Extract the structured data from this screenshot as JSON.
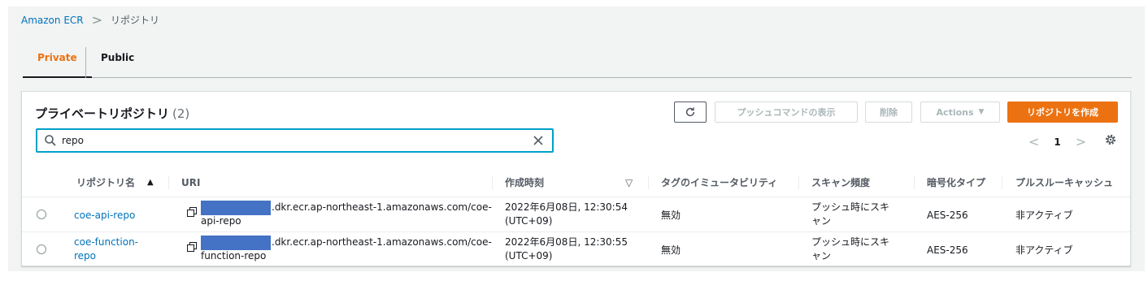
{
  "breadcrumb": {
    "root": "Amazon ECR",
    "separator": ">",
    "current": "リポジトリ"
  },
  "tabs": [
    {
      "label": "Private"
    },
    {
      "label": "Public"
    }
  ],
  "panel": {
    "title": "プライベートリポジトリ",
    "count": "(2)",
    "buttons": {
      "push_commands": "プッシュコマンドの表示",
      "delete": "削除",
      "actions": "Actions",
      "actions_caret": "▼",
      "create": "リポジトリを作成"
    },
    "search": {
      "value": "repo"
    },
    "pagination": {
      "prev": "<",
      "page": "1",
      "next": ">"
    }
  },
  "table": {
    "headers": {
      "name": "リポジトリ名",
      "sort_arrow": "▲",
      "uri": "URI",
      "created": "作成時刻",
      "created_sort": "▽",
      "tag_mutability": "タグのイミュータビリティ",
      "scan_frequency": "スキャン頻度",
      "encryption": "暗号化タイプ",
      "pull_through": "プルスルーキャッシュ"
    },
    "rows": [
      {
        "name_line1": "coe-api-repo",
        "name_line2": "",
        "uri_line1": ".dkr.ecr.ap-northeast-1.amazonaws.com/coe-",
        "uri_line2": "api-repo",
        "created_line1": "2022年6月08日, 12:30:54",
        "created_line2": "(UTC+09)",
        "tag_mutability": "無効",
        "scan_line1": "プッシュ時にスキ",
        "scan_line2": "ャン",
        "encryption": "AES-256",
        "pull_through": "非アクティブ"
      },
      {
        "name_line1": "coe-function-",
        "name_line2": "repo",
        "uri_line1": ".dkr.ecr.ap-northeast-1.amazonaws.com/coe-",
        "uri_line2": "function-repo",
        "created_line1": "2022年6月08日, 12:30:55",
        "created_line2": "(UTC+09)",
        "tag_mutability": "無効",
        "scan_line1": "プッシュ時にスキ",
        "scan_line2": "ャン",
        "encryption": "AES-256",
        "pull_through": "非アクティブ"
      }
    ]
  },
  "colors": {
    "accent": "#ec7211",
    "link": "#0073bb",
    "focus": "#00a1c9",
    "redaction": "#4472c4"
  },
  "icons": [
    "refresh-icon",
    "search-icon",
    "clear-icon",
    "settings-icon",
    "copy-icon"
  ]
}
